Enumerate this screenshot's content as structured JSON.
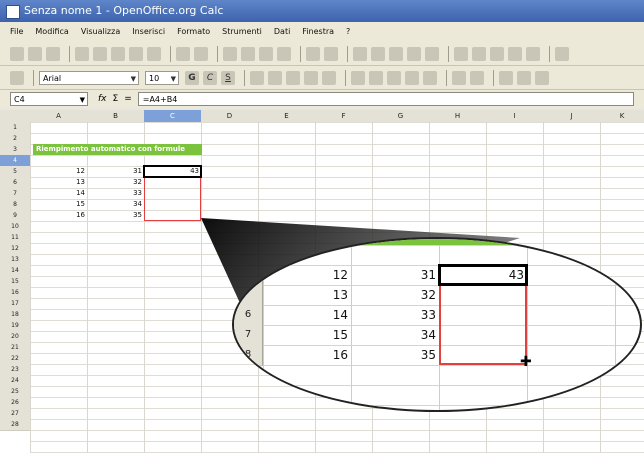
{
  "window": {
    "title": "Senza nome 1 - OpenOffice.org Calc"
  },
  "menu": [
    "File",
    "Modifica",
    "Visualizza",
    "Inserisci",
    "Formato",
    "Strumenti",
    "Dati",
    "Finestra",
    "?"
  ],
  "toolbar2": {
    "font_name": "Arial",
    "font_size": "10",
    "bold": "G",
    "italic": "C",
    "underline": "S"
  },
  "formula_bar": {
    "name_box": "C4",
    "fx": "fx",
    "sum": "Σ",
    "equals": "=",
    "formula": "=A4+B4"
  },
  "columns": [
    "A",
    "B",
    "C",
    "D",
    "E",
    "F",
    "G",
    "H",
    "I",
    "J",
    "K"
  ],
  "rows": [
    "1",
    "2",
    "3",
    "4",
    "5",
    "6",
    "7",
    "8",
    "9",
    "10",
    "11",
    "12",
    "13",
    "14",
    "15",
    "16",
    "17",
    "18",
    "19",
    "20",
    "21",
    "22",
    "23",
    "24",
    "25",
    "26",
    "27",
    "28"
  ],
  "sheet": {
    "heading": "Riempimento automatico con formule",
    "col_a": [
      "12",
      "13",
      "14",
      "15",
      "16"
    ],
    "col_b": [
      "31",
      "32",
      "33",
      "34",
      "35"
    ],
    "c4": "43"
  },
  "zoom": {
    "row_labels": [
      "",
      "",
      "6",
      "7",
      "8"
    ],
    "col_a": [
      "12",
      "13",
      "14",
      "15",
      "16"
    ],
    "col_b": [
      "31",
      "32",
      "33",
      "34",
      "35"
    ],
    "c4": "43"
  },
  "colors": {
    "heading_green": "#7cc33d",
    "selection_red": "#e23f3f",
    "header_selected": "#7da0d8"
  }
}
